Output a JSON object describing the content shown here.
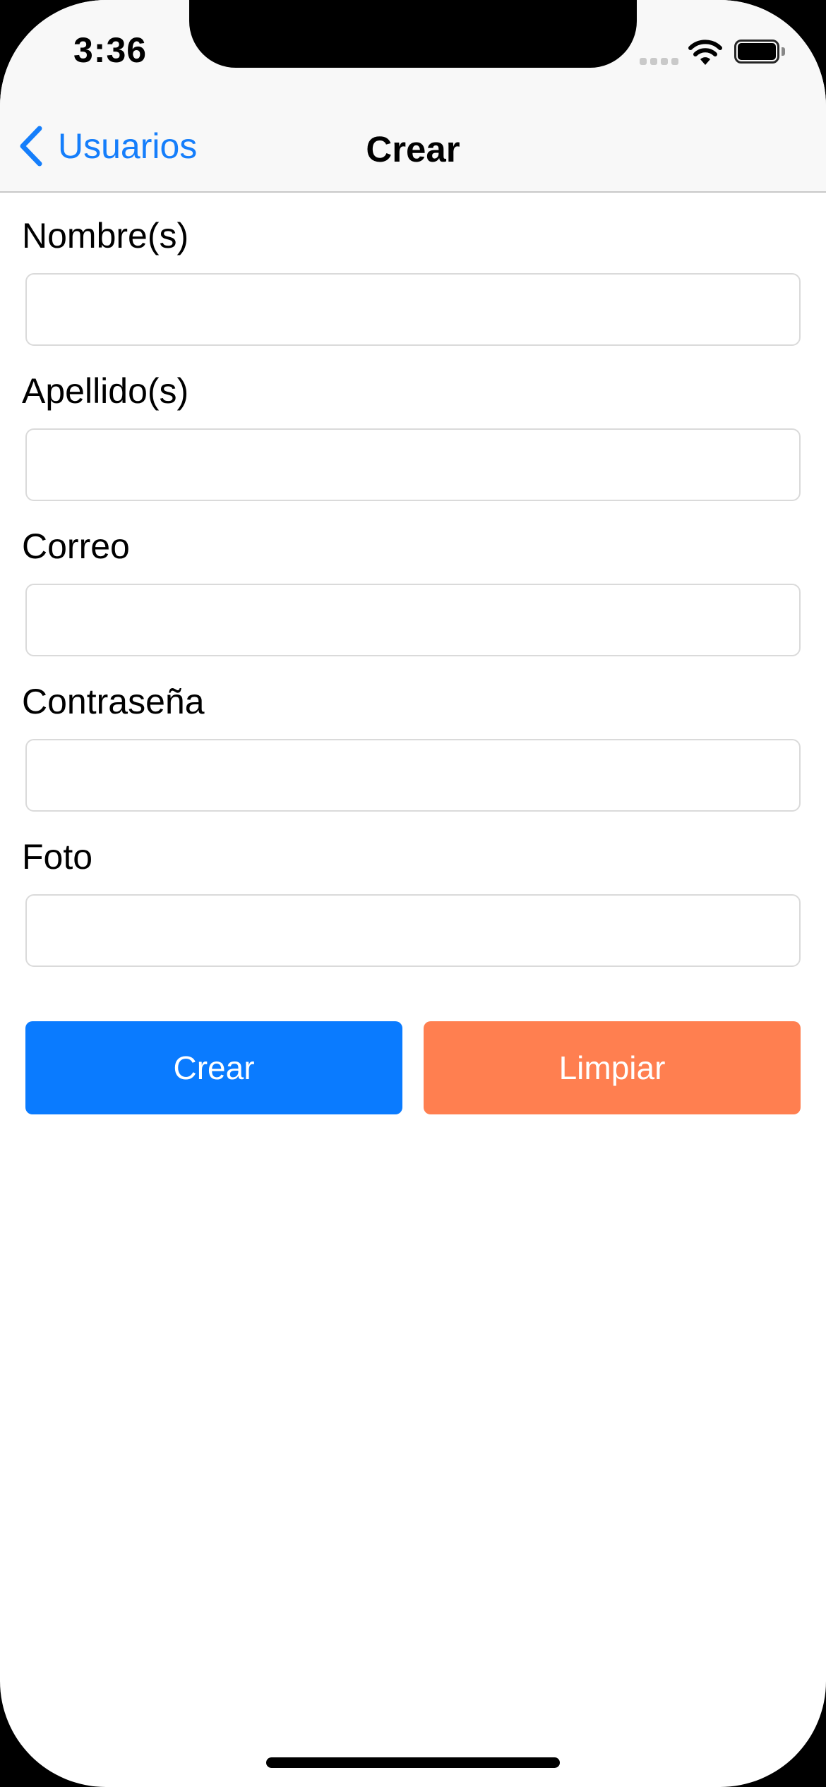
{
  "status_bar": {
    "time": "3:36",
    "signal_icon": "cellular-signal-icon",
    "wifi_icon": "wifi-icon",
    "battery_icon": "battery-icon"
  },
  "nav": {
    "back_label": "Usuarios",
    "back_icon": "chevron-left-icon",
    "title": "Crear"
  },
  "form": {
    "fields": [
      {
        "label": "Nombre(s)",
        "value": "",
        "placeholder": ""
      },
      {
        "label": "Apellido(s)",
        "value": "",
        "placeholder": ""
      },
      {
        "label": "Correo",
        "value": "",
        "placeholder": ""
      },
      {
        "label": "Contraseña",
        "value": "",
        "placeholder": ""
      },
      {
        "label": "Foto",
        "value": "",
        "placeholder": ""
      }
    ],
    "create_label": "Crear",
    "clear_label": "Limpiar"
  },
  "colors": {
    "accent": "#157efb",
    "create_button": "#0a7bff",
    "clear_button": "#ff7f50",
    "nav_background": "#f8f8f8"
  }
}
